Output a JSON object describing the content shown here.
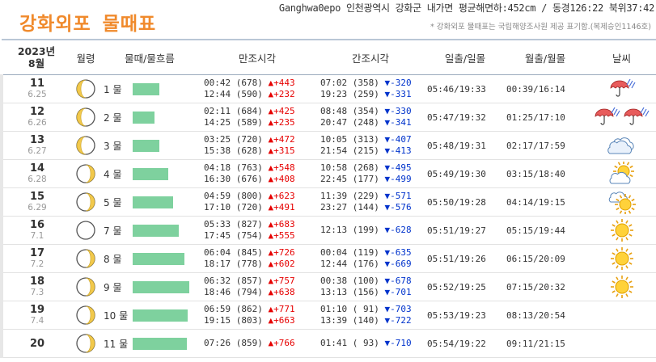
{
  "header": {
    "title_a": "강화외포",
    "title_b": "물때표",
    "location": "Ganghwa0epo 인천광역시 강화군 내가면 평균해면하:452cm / 동경126:22 북위37:42",
    "note": "* 강화외포 물때표는 국립해양조사원 제공 표기함.(복제승인1146호)"
  },
  "columns": {
    "date_year": "2023년",
    "date_month": "8월",
    "moon": "월령",
    "tide_flow": "물때/물흐름",
    "high": "만조시각",
    "low": "간조시각",
    "sun": "일출/일몰",
    "moonrise": "월출/월몰",
    "weather": "날씨"
  },
  "rows": [
    {
      "day": "11",
      "lunar": "6.25",
      "moon_phase": "waning-crescent",
      "tide_label": "1 물",
      "tide_level": 0.41,
      "high": [
        {
          "time": "00:42",
          "level": "(678)",
          "dir": "▲",
          "diff": "+443"
        },
        {
          "time": "12:44",
          "level": "(590)",
          "dir": "▲",
          "diff": "+232"
        }
      ],
      "low": [
        {
          "time": "07:02",
          "level": "(358)",
          "dir": "▼",
          "diff": "-320"
        },
        {
          "time": "19:23",
          "level": "(259)",
          "dir": "▼",
          "diff": "-331"
        }
      ],
      "sun": "05:46/19:33",
      "moonrise": "00:39/16:14",
      "weather": [
        "rain"
      ]
    },
    {
      "day": "12",
      "lunar": "6.26",
      "moon_phase": "waning-crescent",
      "tide_label": "2 물",
      "tide_level": 0.34,
      "high": [
        {
          "time": "02:11",
          "level": "(684)",
          "dir": "▲",
          "diff": "+425"
        },
        {
          "time": "14:25",
          "level": "(589)",
          "dir": "▲",
          "diff": "+235"
        }
      ],
      "low": [
        {
          "time": "08:48",
          "level": "(354)",
          "dir": "▼",
          "diff": "-330"
        },
        {
          "time": "20:47",
          "level": "(248)",
          "dir": "▼",
          "diff": "-341"
        }
      ],
      "sun": "05:47/19:32",
      "moonrise": "01:25/17:10",
      "weather": [
        "umbrella",
        "umbrella"
      ]
    },
    {
      "day": "13",
      "lunar": "6.27",
      "moon_phase": "waning-crescent",
      "tide_label": "3 물",
      "tide_level": 0.41,
      "high": [
        {
          "time": "03:25",
          "level": "(720)",
          "dir": "▲",
          "diff": "+472"
        },
        {
          "time": "15:38",
          "level": "(628)",
          "dir": "▲",
          "diff": "+315"
        }
      ],
      "low": [
        {
          "time": "10:05",
          "level": "(313)",
          "dir": "▼",
          "diff": "-407"
        },
        {
          "time": "21:54",
          "level": "(215)",
          "dir": "▼",
          "diff": "-413"
        }
      ],
      "sun": "05:48/19:31",
      "moonrise": "02:17/17:59",
      "weather": [
        "cloud"
      ]
    },
    {
      "day": "14",
      "lunar": "6.28",
      "moon_phase": "waxing-crescent",
      "tide_label": "4 물",
      "tide_level": 0.55,
      "high": [
        {
          "time": "04:18",
          "level": "(763)",
          "dir": "▲",
          "diff": "+548"
        },
        {
          "time": "16:30",
          "level": "(676)",
          "dir": "▲",
          "diff": "+408"
        }
      ],
      "low": [
        {
          "time": "10:58",
          "level": "(268)",
          "dir": "▼",
          "diff": "-495"
        },
        {
          "time": "22:45",
          "level": "(177)",
          "dir": "▼",
          "diff": "-499"
        }
      ],
      "sun": "05:49/19:30",
      "moonrise": "03:15/18:40",
      "weather": [
        "sun-cloud"
      ]
    },
    {
      "day": "15",
      "lunar": "6.29",
      "moon_phase": "waxing-crescent",
      "tide_label": "5 물",
      "tide_level": 0.62,
      "high": [
        {
          "time": "04:59",
          "level": "(800)",
          "dir": "▲",
          "diff": "+623"
        },
        {
          "time": "17:10",
          "level": "(720)",
          "dir": "▲",
          "diff": "+491"
        }
      ],
      "low": [
        {
          "time": "11:39",
          "level": "(229)",
          "dir": "▼",
          "diff": "-571"
        },
        {
          "time": "23:27",
          "level": "(144)",
          "dir": "▼",
          "diff": "-576"
        }
      ],
      "sun": "05:50/19:28",
      "moonrise": "04:14/19:15",
      "weather": [
        "cloud-sun"
      ]
    },
    {
      "day": "16",
      "lunar": "7.1",
      "moon_phase": "new",
      "tide_label": "7 물",
      "tide_level": 0.71,
      "high": [
        {
          "time": "05:33",
          "level": "(827)",
          "dir": "▲",
          "diff": "+683"
        },
        {
          "time": "17:45",
          "level": "(754)",
          "dir": "▲",
          "diff": "+555"
        }
      ],
      "low": [
        {
          "time": "12:13",
          "level": "(199)",
          "dir": "▼",
          "diff": "-628"
        }
      ],
      "sun": "05:51/19:27",
      "moonrise": "05:15/19:44",
      "weather": [
        "sun"
      ]
    },
    {
      "day": "17",
      "lunar": "7.2",
      "moon_phase": "waxing-crescent",
      "tide_label": "8 물",
      "tide_level": 0.8,
      "high": [
        {
          "time": "06:04",
          "level": "(845)",
          "dir": "▲",
          "diff": "+726"
        },
        {
          "time": "18:17",
          "level": "(778)",
          "dir": "▲",
          "diff": "+602"
        }
      ],
      "low": [
        {
          "time": "00:04",
          "level": "(119)",
          "dir": "▼",
          "diff": "-635"
        },
        {
          "time": "12:44",
          "level": "(176)",
          "dir": "▼",
          "diff": "-669"
        }
      ],
      "sun": "05:51/19:26",
      "moonrise": "06:15/20:09",
      "weather": [
        "sun"
      ]
    },
    {
      "day": "18",
      "lunar": "7.3",
      "moon_phase": "waxing-crescent",
      "tide_label": "9 물",
      "tide_level": 0.87,
      "high": [
        {
          "time": "06:32",
          "level": "(857)",
          "dir": "▲",
          "diff": "+757"
        },
        {
          "time": "18:46",
          "level": "(794)",
          "dir": "▲",
          "diff": "+638"
        }
      ],
      "low": [
        {
          "time": "00:38",
          "level": "(100)",
          "dir": "▼",
          "diff": "-678"
        },
        {
          "time": "13:13",
          "level": "(156)",
          "dir": "▼",
          "diff": "-701"
        }
      ],
      "sun": "05:52/19:25",
      "moonrise": "07:15/20:32",
      "weather": [
        "sun"
      ]
    },
    {
      "day": "19",
      "lunar": "7.4",
      "moon_phase": "waxing-crescent",
      "tide_label": "10 물",
      "tide_level": 0.85,
      "high": [
        {
          "time": "06:59",
          "level": "(862)",
          "dir": "▲",
          "diff": "+771"
        },
        {
          "time": "19:15",
          "level": "(803)",
          "dir": "▲",
          "diff": "+663"
        }
      ],
      "low": [
        {
          "time": "01:10",
          "level": "( 91)",
          "dir": "▼",
          "diff": "-703"
        },
        {
          "time": "13:39",
          "level": "(140)",
          "dir": "▼",
          "diff": "-722"
        }
      ],
      "sun": "05:53/19:23",
      "moonrise": "08:13/20:54",
      "weather": []
    },
    {
      "day": "20",
      "lunar": "",
      "moon_phase": "waxing-crescent",
      "tide_label": "11 물",
      "tide_level": 0.84,
      "high": [
        {
          "time": "07:26",
          "level": "(859)",
          "dir": "▲",
          "diff": "+766"
        },
        {
          "time": "",
          "level": "",
          "dir": "",
          "diff": ""
        }
      ],
      "low": [
        {
          "time": "01:41",
          "level": "( 93)",
          "dir": "▼",
          "diff": "-710"
        },
        {
          "time": "",
          "level": "",
          "dir": "",
          "diff": ""
        }
      ],
      "sun": "05:54/19:22",
      "moonrise": "09:11/21:15",
      "weather": []
    }
  ]
}
